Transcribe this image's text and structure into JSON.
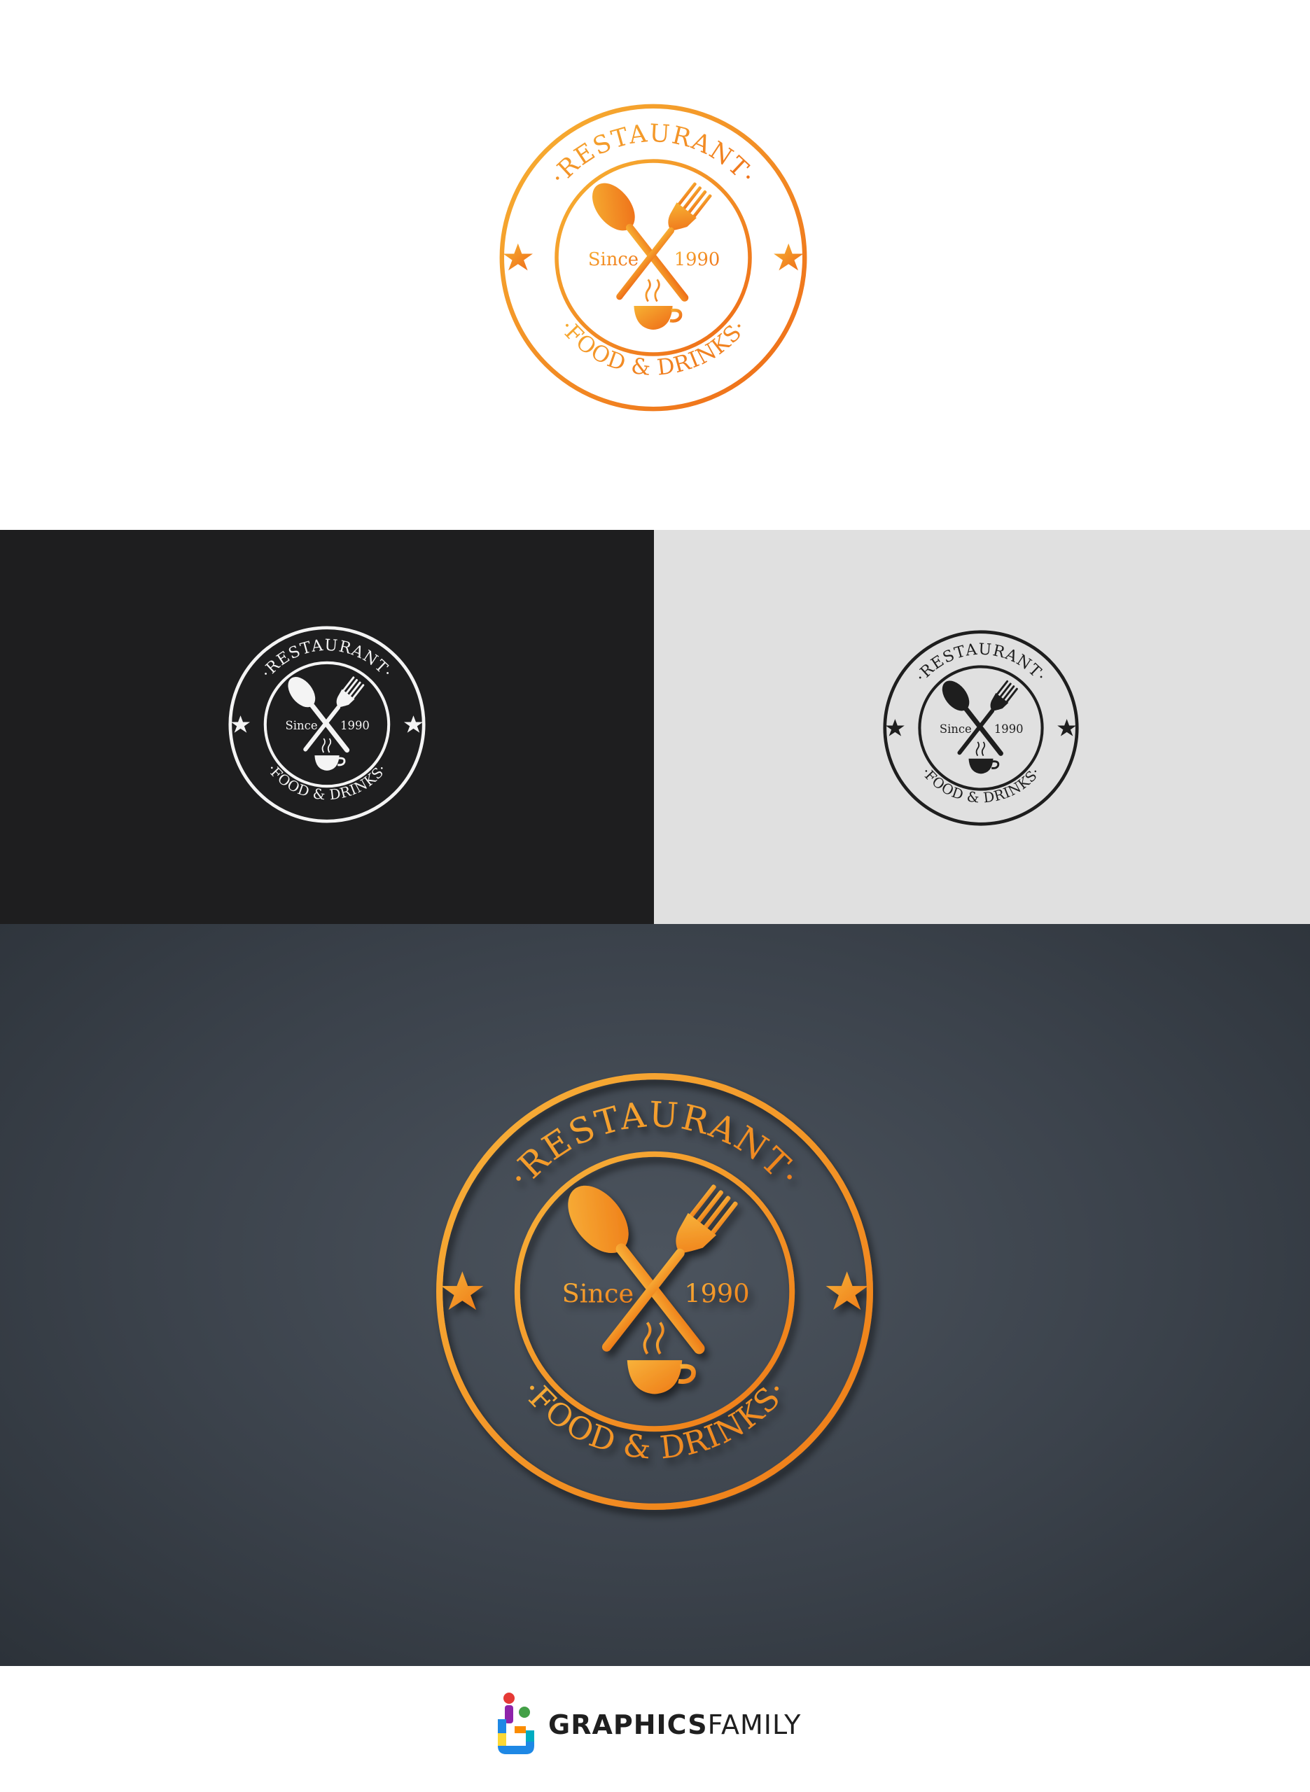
{
  "logo": {
    "top_text": "·RESTAURANT·",
    "bottom_text": "·FOOD & DRINKS·",
    "since_label": "Since",
    "year": "1990"
  },
  "variants": [
    {
      "name": "orange-on-white",
      "color": "#f28a1b"
    },
    {
      "name": "white-on-black",
      "color": "#ffffff"
    },
    {
      "name": "black-on-grey",
      "color": "#1e1e1e"
    },
    {
      "name": "3d-orange-on-slate",
      "color": "#f39a1f"
    }
  ],
  "footer": {
    "brand_bold": "GRAPHICS",
    "brand_thin": "FAMILY"
  },
  "colors": {
    "accent": "#f28a1b",
    "dark_panel": "#1e1e1f",
    "light_panel": "#e0e0e0",
    "slate_panel": "#3b424b"
  }
}
